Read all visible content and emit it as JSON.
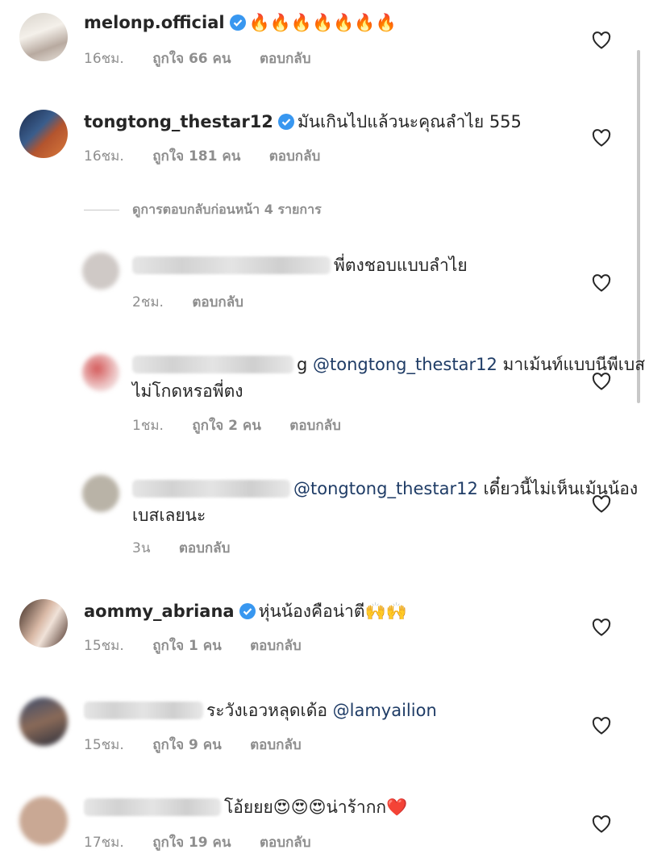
{
  "comments": [
    {
      "username": "melonp.official",
      "verified": true,
      "text": "🔥🔥🔥🔥🔥🔥🔥",
      "time": "16ชม.",
      "likes": "ถูกใจ 66 คน",
      "reply": "ตอบกลับ"
    },
    {
      "username": "tongtong_thestar12",
      "verified": true,
      "text": "มันเกินไปแล้วนะคุณลำไย 555",
      "time": "16ชม.",
      "likes": "ถูกใจ 181 คน",
      "reply": "ตอบกลับ"
    },
    {
      "username": "aommy_abriana",
      "verified": true,
      "text": "หุ่นน้องคือน่าตี🙌🙌",
      "time": "15ชม.",
      "likes": "ถูกใจ 1 คน",
      "reply": "ตอบกลับ"
    },
    {
      "username": "",
      "verified": false,
      "text": "ระวังเอวหลุดเด้อ ",
      "mention": "@lamyailion",
      "time": "15ชม.",
      "likes": "ถูกใจ 9 คน",
      "reply": "ตอบกลับ"
    },
    {
      "username": "",
      "verified": false,
      "text": "โอ้ยยย😍😍😍น่าร้ากก❤️",
      "time": "17ชม.",
      "likes": "ถูกใจ 19 คน",
      "reply": "ตอบกลับ"
    }
  ],
  "view_previous": "ดูการตอบกลับก่อนหน้า 4 รายการ",
  "replies": [
    {
      "text": "พี่ตงชอบแบบลำไย",
      "time": "2ชม.",
      "reply": "ตอบกลับ"
    },
    {
      "last_char": "g ",
      "mention": "@tongtong_thestar12",
      "text": " มาเม้นท์แบบนีพีเบสไม่โกดหรอพี่ตง",
      "time": "1ชม.",
      "likes": "ถูกใจ 2 คน",
      "reply": "ตอบกลับ"
    },
    {
      "mention": "@tongtong_thestar12",
      "text": " เดี๋ยวนี้ไม่เห็นเม้นน้องเบสเลยนะ",
      "time": "3น",
      "reply": "ตอบกลับ"
    }
  ],
  "colors": {
    "verified": "#3897f0",
    "mention": "#1f3c66",
    "meta": "#8e8e8e",
    "heart": "#262626"
  }
}
